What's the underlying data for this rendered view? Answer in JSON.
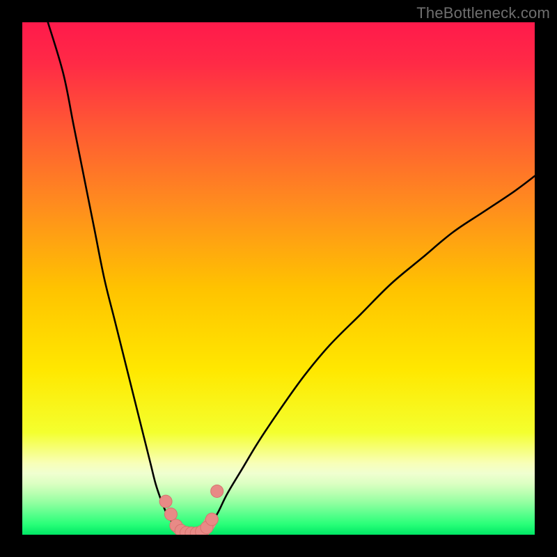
{
  "watermark": {
    "text": "TheBottleneck.com"
  },
  "colors": {
    "black": "#000000",
    "curve": "#000000",
    "marker_fill": "#e88a86",
    "marker_stroke": "#d6726e",
    "stops": [
      {
        "offset": "0%",
        "color": "#ff1a4b"
      },
      {
        "offset": "8%",
        "color": "#ff2a46"
      },
      {
        "offset": "20%",
        "color": "#ff5734"
      },
      {
        "offset": "35%",
        "color": "#ff8a1f"
      },
      {
        "offset": "52%",
        "color": "#ffc300"
      },
      {
        "offset": "68%",
        "color": "#ffe800"
      },
      {
        "offset": "80%",
        "color": "#f4ff2e"
      },
      {
        "offset": "86%",
        "color": "#f8ffb7"
      },
      {
        "offset": "88%",
        "color": "#f0ffd0"
      },
      {
        "offset": "90%",
        "color": "#dcffc2"
      },
      {
        "offset": "92%",
        "color": "#b7ffb0"
      },
      {
        "offset": "94%",
        "color": "#8cff9e"
      },
      {
        "offset": "96%",
        "color": "#58ff8c"
      },
      {
        "offset": "98%",
        "color": "#28ff78"
      },
      {
        "offset": "100%",
        "color": "#00e765"
      }
    ]
  },
  "chart_data": {
    "type": "line",
    "title": "",
    "xlabel": "",
    "ylabel": "",
    "xlim": [
      0,
      100
    ],
    "ylim": [
      0,
      100
    ],
    "note": "Axes unlabeled; values are relative (0-100 each axis), estimated from pixel positions.",
    "series": [
      {
        "name": "left-arm",
        "x": [
          5,
          8,
          10,
          12,
          14,
          16,
          18,
          20,
          22,
          23.5,
          25,
          26,
          27,
          28,
          29,
          30,
          31
        ],
        "y": [
          100,
          90,
          80,
          70,
          60,
          50,
          42,
          34,
          26,
          20,
          14,
          10,
          7,
          4.5,
          2.8,
          1.6,
          0.8
        ]
      },
      {
        "name": "right-arm",
        "x": [
          36,
          38,
          40,
          43,
          46,
          50,
          55,
          60,
          66,
          72,
          78,
          84,
          90,
          96,
          100
        ],
        "y": [
          1.2,
          4,
          8,
          13,
          18,
          24,
          31,
          37,
          43,
          49,
          54,
          59,
          63,
          67,
          70
        ]
      },
      {
        "name": "valley-floor",
        "x": [
          31,
          32,
          33,
          34,
          35,
          36
        ],
        "y": [
          0.8,
          0.4,
          0.3,
          0.3,
          0.5,
          1.2
        ]
      }
    ],
    "markers": {
      "name": "highlighted-points",
      "x": [
        28,
        29,
        30,
        31,
        32,
        33,
        34,
        35,
        36,
        37,
        38
      ],
      "y": [
        6.5,
        4.0,
        1.8,
        0.8,
        0.4,
        0.3,
        0.3,
        0.6,
        1.4,
        3.0,
        8.5
      ]
    },
    "minimum": {
      "x": 33.5,
      "y": 0.3
    }
  }
}
